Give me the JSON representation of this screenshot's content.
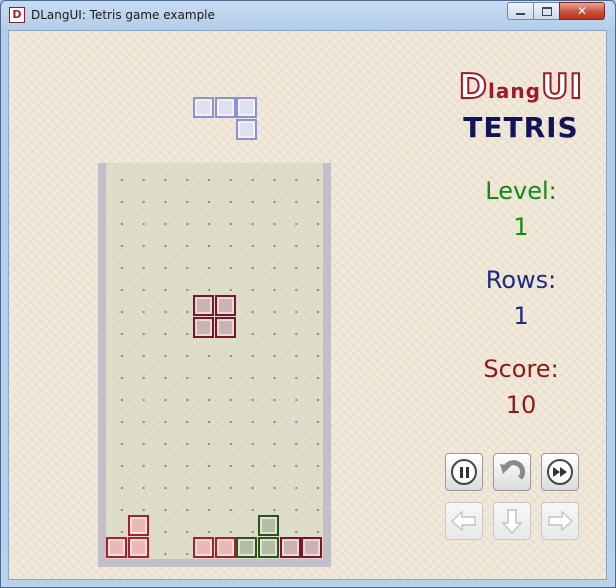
{
  "window": {
    "title": "DLangUI: Tetris game example",
    "icon_letter": "D",
    "controls": {
      "minimize": "minimize-icon",
      "maximize": "maximize-icon",
      "close": "close-icon"
    }
  },
  "logo": {
    "big_d": "D",
    "lang": "lang",
    "ui": "UI",
    "tetris": "TETRIS"
  },
  "stats": {
    "level_label": "Level:",
    "level_value": "1",
    "rows_label": "Rows:",
    "rows_value": "1",
    "score_label": "Score:",
    "score_value": "10"
  },
  "colors": {
    "level": "#138a13",
    "rows": "#1f2a80",
    "score": "#8e1a14",
    "piece_red": "#ad1f2b",
    "piece_red_fill": "#e8b9b6",
    "piece_maroon": "#7e1428",
    "piece_maroon_fill": "#cbb2b3",
    "piece_green": "#2e5218",
    "piece_green_fill": "#b5bea4",
    "piece_preview": "#8f91d8",
    "piece_preview_fill": "#dfe0ef"
  },
  "controls": [
    {
      "name": "pause-button",
      "icon": "pause-icon"
    },
    {
      "name": "rotate-button",
      "icon": "rotate-icon"
    },
    {
      "name": "fast-forward-button",
      "icon": "fast-forward-icon"
    },
    {
      "name": "left-button",
      "icon": "arrow-left-icon",
      "disabled": true
    },
    {
      "name": "down-button",
      "icon": "arrow-down-icon",
      "disabled": true
    },
    {
      "name": "right-button",
      "icon": "arrow-right-icon",
      "disabled": true
    }
  ],
  "board": {
    "cols": 10,
    "rows": 18
  },
  "next_piece": {
    "shape": "J",
    "cells": [
      [
        0,
        0
      ],
      [
        1,
        0
      ],
      [
        2,
        0
      ],
      [
        2,
        1
      ]
    ]
  },
  "falling_piece": {
    "shape": "O",
    "cells": [
      [
        4,
        6
      ],
      [
        5,
        6
      ],
      [
        4,
        7
      ],
      [
        5,
        7
      ]
    ]
  },
  "settled_cells": [
    {
      "col": 1,
      "row": 16,
      "color": "red"
    },
    {
      "col": 0,
      "row": 17,
      "color": "red"
    },
    {
      "col": 1,
      "row": 17,
      "color": "red"
    },
    {
      "col": 4,
      "row": 17,
      "color": "red"
    },
    {
      "col": 5,
      "row": 17,
      "color": "red"
    },
    {
      "col": 7,
      "row": 16,
      "color": "green"
    },
    {
      "col": 6,
      "row": 17,
      "color": "green"
    },
    {
      "col": 7,
      "row": 17,
      "color": "green"
    },
    {
      "col": 8,
      "row": 17,
      "color": "maroon"
    },
    {
      "col": 9,
      "row": 17,
      "color": "maroon"
    }
  ]
}
